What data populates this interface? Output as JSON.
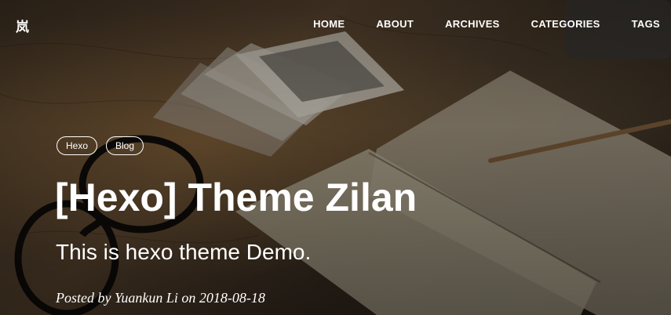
{
  "site": {
    "logo": "岚"
  },
  "nav": {
    "items": [
      "HOME",
      "ABOUT",
      "ARCHIVES",
      "CATEGORIES",
      "TAGS"
    ]
  },
  "post": {
    "tags": [
      "Hexo",
      "Blog"
    ],
    "title": "[Hexo] Theme Zilan",
    "subtitle": "This is hexo theme Demo.",
    "meta_prefix": "Posted by",
    "author": "Yuankun Li",
    "meta_on": "on",
    "date": "2018-08-18"
  },
  "colors": {
    "text": "#ffffff",
    "overlay": "#000000"
  }
}
